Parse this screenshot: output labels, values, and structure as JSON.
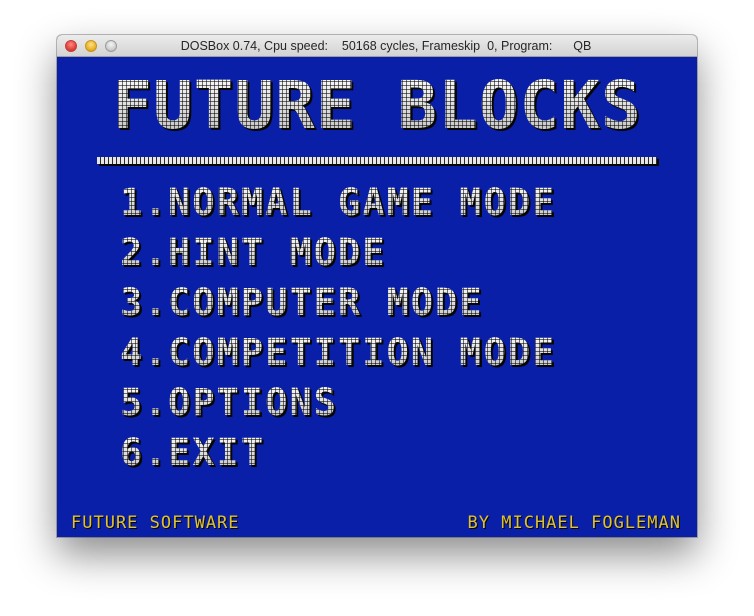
{
  "window": {
    "title": "DOSBox 0.74, Cpu speed:    50168 cycles, Frameskip  0, Program:      QB",
    "controls": [
      "close-icon",
      "minimize-icon",
      "zoom-icon"
    ]
  },
  "game": {
    "title": "FUTURE BLOCKS",
    "menu": [
      {
        "number": "1.",
        "label": "NORMAL GAME MODE"
      },
      {
        "number": "2.",
        "label": "HINT MODE"
      },
      {
        "number": "3.",
        "label": "COMPUTER MODE"
      },
      {
        "number": "4.",
        "label": "COMPETITION MODE"
      },
      {
        "number": "5.",
        "label": "OPTIONS"
      },
      {
        "number": "6.",
        "label": "EXIT"
      }
    ],
    "footer_left": "FUTURE SOFTWARE",
    "footer_right": "BY MICHAEL FOGLEMAN"
  },
  "colors": {
    "screen_background": "#0a1fa8",
    "title_text": "#d8d8d8",
    "footer_text": "#e0c230"
  }
}
